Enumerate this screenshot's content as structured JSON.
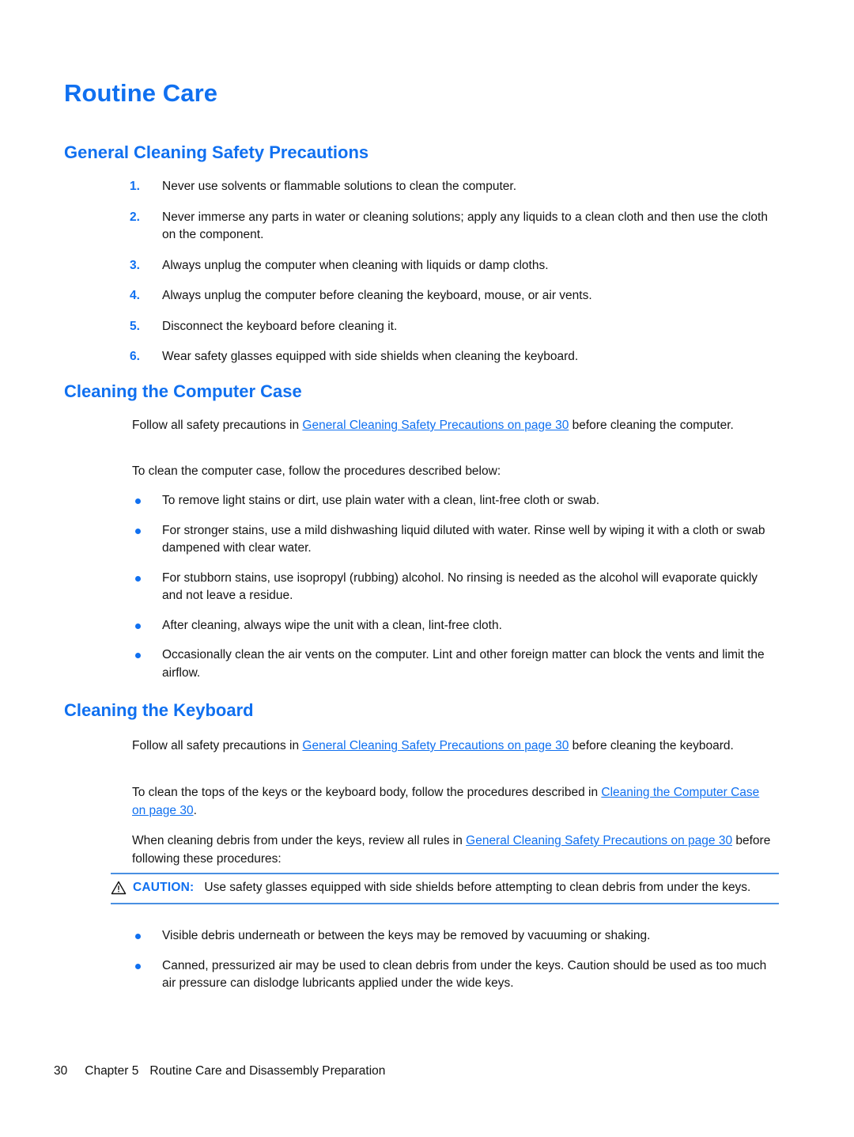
{
  "page": {
    "title": "Routine Care",
    "page_number": "30"
  },
  "sections": {
    "general": {
      "heading": "General Cleaning Safety Precautions",
      "items": [
        {
          "marker": "1.",
          "text": "Never use solvents or flammable solutions to clean the computer."
        },
        {
          "marker": "2.",
          "text": "Never immerse any parts in water or cleaning solutions; apply any liquids to a clean cloth and then use the cloth on the component."
        },
        {
          "marker": "3.",
          "text": "Always unplug the computer when cleaning with liquids or damp cloths."
        },
        {
          "marker": "4.",
          "text": "Always unplug the computer before cleaning the keyboard, mouse, or air vents."
        },
        {
          "marker": "5.",
          "text": "Disconnect the keyboard before cleaning it."
        },
        {
          "marker": "6.",
          "text": "Wear safety glasses equipped with side shields when cleaning the keyboard."
        }
      ]
    },
    "computer_case": {
      "heading": "Cleaning the Computer Case",
      "para1_before": "Follow all safety precautions in ",
      "para1_link": "General Cleaning Safety Precautions on page 30",
      "para1_after": " before cleaning the computer.",
      "para2": "To clean the computer case, follow the procedures described below:",
      "bullets": [
        "To remove light stains or dirt, use plain water with a clean, lint-free cloth or swab.",
        "For stronger stains, use a mild dishwashing liquid diluted with water. Rinse well by wiping it with a cloth or swab dampened with clear water.",
        "For stubborn stains, use isopropyl (rubbing) alcohol. No rinsing is needed as the alcohol will evaporate quickly and not leave a residue.",
        "After cleaning, always wipe the unit with a clean, lint-free cloth.",
        "Occasionally clean the air vents on the computer. Lint and other foreign matter can block the vents and limit the airflow."
      ]
    },
    "keyboard": {
      "heading": "Cleaning the Keyboard",
      "para1_before": "Follow all safety precautions in ",
      "para1_link": "General Cleaning Safety Precautions on page 30",
      "para1_after": " before cleaning the keyboard.",
      "para2_before": "To clean the tops of the keys or the keyboard body, follow the procedures described in ",
      "para2_link": "Cleaning the Computer Case on page 30",
      "para2_after": ".",
      "para3_before": "When cleaning debris from under the keys, review all rules in ",
      "para3_link": "General Cleaning Safety Precautions on page 30",
      "para3_after": " before following these procedures:",
      "caution": {
        "label": "CAUTION:",
        "text": "Use safety glasses equipped with side shields before attempting to clean debris from under the keys."
      },
      "bullets": [
        "Visible debris underneath or between the keys may be removed by vacuuming or shaking.",
        "Canned, pressurized air may be used to clean debris from under the keys. Caution should be used as too much air pressure can dislodge lubricants applied under the wide keys."
      ]
    }
  },
  "footer": {
    "page_number": "30",
    "chapter": "Chapter 5",
    "chapter_title": "Routine Care and Disassembly Preparation"
  },
  "colors": {
    "heading_blue": "#1070f0",
    "link_blue": "#1070f0",
    "rule_blue": "#4a90e2",
    "body_black": "#141414"
  }
}
